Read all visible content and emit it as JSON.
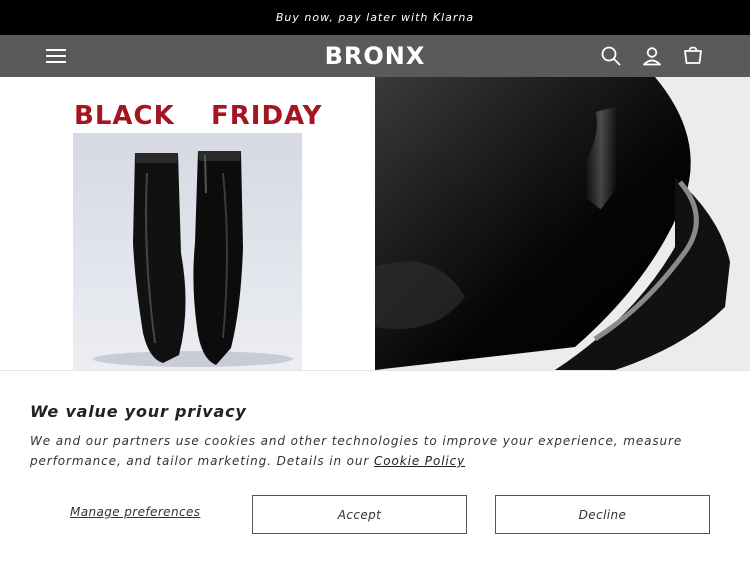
{
  "announcement": {
    "text": "Buy now, pay later with Klarna"
  },
  "header": {
    "logo": "BRONX",
    "icons": [
      "menu-icon",
      "search-icon",
      "account-icon",
      "cart-icon"
    ],
    "bg_color": "#5a5a5a"
  },
  "hero": {
    "left": {
      "word1": "BLACK",
      "word2": "FRIDAY"
    },
    "accent_color": "#a5151f"
  },
  "privacy": {
    "title": "We value your privacy",
    "body": "We and our partners use cookies and other technologies to improve your experience, measure performance, and tailor marketing. Details in our",
    "link": "Cookie Policy",
    "manage": "Manage preferences",
    "accept": "Accept",
    "decline": "Decline"
  }
}
